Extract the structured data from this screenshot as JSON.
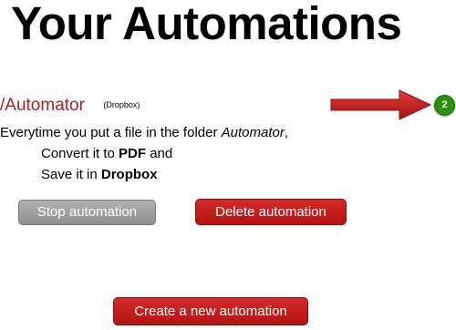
{
  "page": {
    "title": "Your Automations"
  },
  "automation": {
    "name": "/Automator",
    "service": "(Dropbox)",
    "count": "2",
    "description": {
      "prefix": "Everytime you put a file in the folder ",
      "folder": "Automator",
      "suffix": ","
    },
    "steps": [
      {
        "prefix": "Convert it to ",
        "bold": "PDF",
        "suffix": " and"
      },
      {
        "prefix": "Save it in ",
        "bold": "Dropbox",
        "suffix": ""
      }
    ],
    "stop_label": "Stop automation",
    "delete_label": "Delete automation"
  },
  "actions": {
    "create_label": "Create a new automation"
  },
  "colors": {
    "link_red": "#b01c1c",
    "button_red": "#c41e1e",
    "button_grey": "#9e9e9e",
    "badge_green": "#2f8f12",
    "arrow_red": "#c42020"
  },
  "icons": {
    "arrow": "arrow-right-icon"
  }
}
